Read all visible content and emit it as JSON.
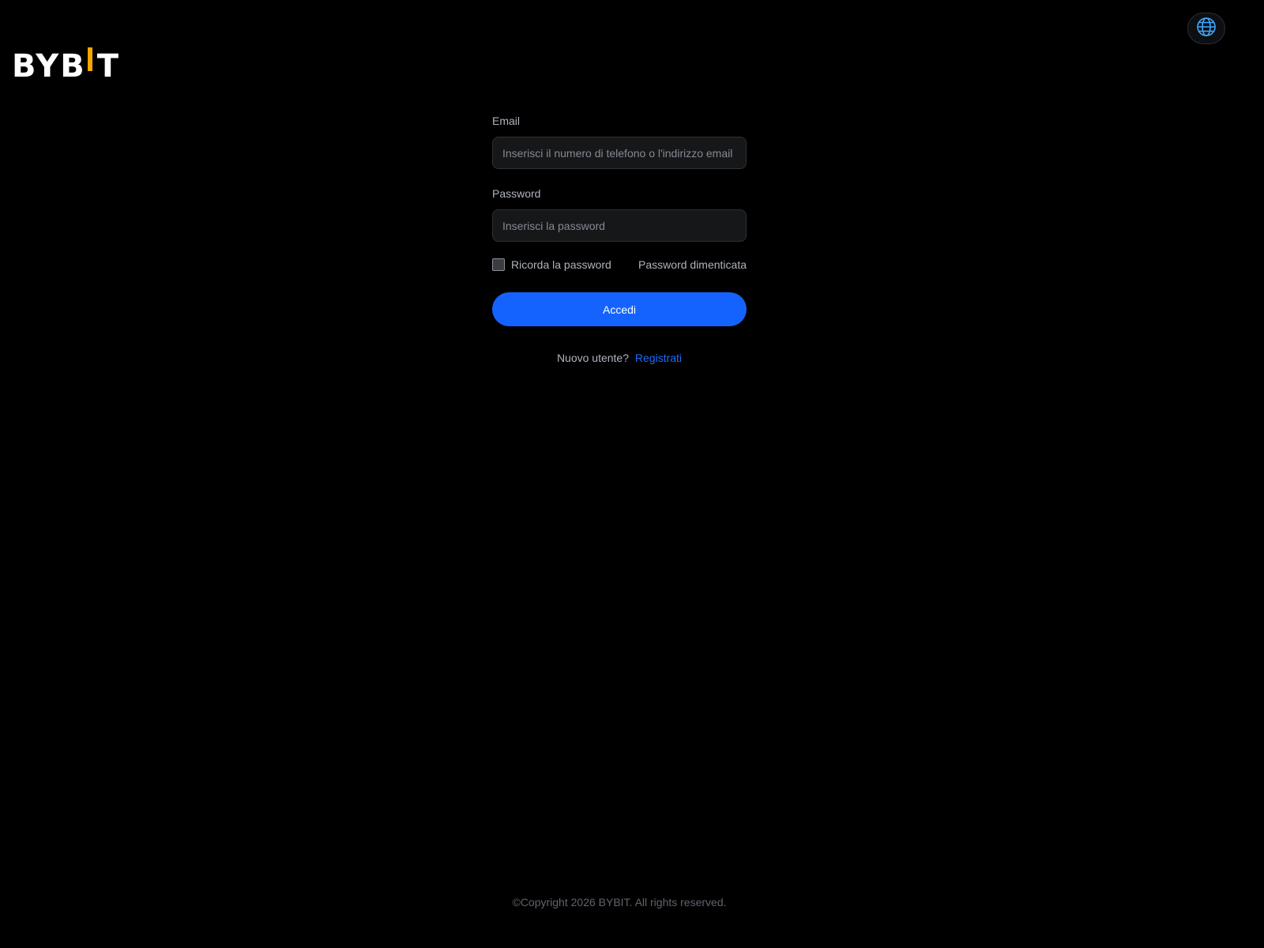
{
  "brand": {
    "name": "BYBIT",
    "accent_color": "#f7a600"
  },
  "header": {
    "language_icon": "globe-icon"
  },
  "login_form": {
    "email_label": "Email",
    "email_placeholder": "Inserisci il numero di telefono o l'indirizzo email",
    "email_value": "",
    "password_label": "Password",
    "password_placeholder": "Inserisci la password",
    "password_value": "",
    "remember_label": "Ricorda la password",
    "remember_checked": false,
    "forgot_label": "Password dimenticata",
    "submit_label": "Accedi",
    "signup_prompt": "Nuovo utente?",
    "signup_link": "Registrati"
  },
  "colors": {
    "background": "#000000",
    "primary_button": "#1463ff",
    "link": "#1d6bff"
  },
  "footer": {
    "copyright": "©Copyright 2026 BYBIT. All rights reserved."
  }
}
